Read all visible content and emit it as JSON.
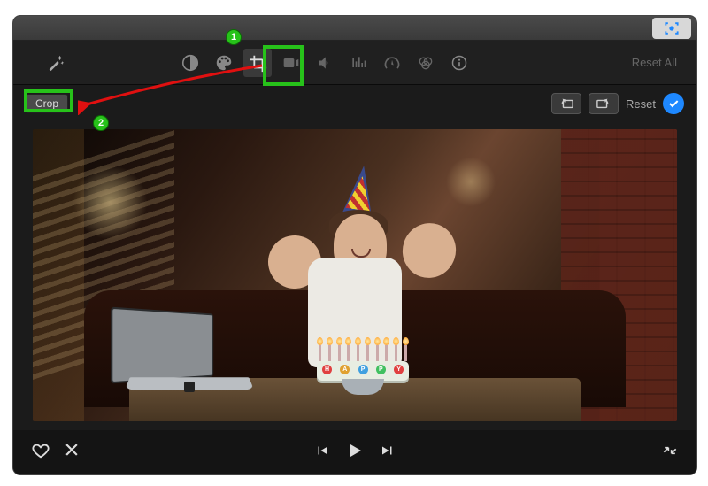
{
  "toolbar": {
    "reset_all": "Reset All"
  },
  "subbar": {
    "crop_label": "Crop",
    "reset_label": "Reset"
  },
  "callouts": {
    "step1": "1",
    "step2": "2"
  },
  "cake_letters": [
    {
      "t": "H",
      "c": "#e04040"
    },
    {
      "t": "A",
      "c": "#e0a030"
    },
    {
      "t": "P",
      "c": "#40a0e0"
    },
    {
      "t": "P",
      "c": "#40c060"
    },
    {
      "t": "Y",
      "c": "#e04040"
    }
  ],
  "colors": {
    "accent": "#1e88ff",
    "callout": "#27c21a"
  }
}
